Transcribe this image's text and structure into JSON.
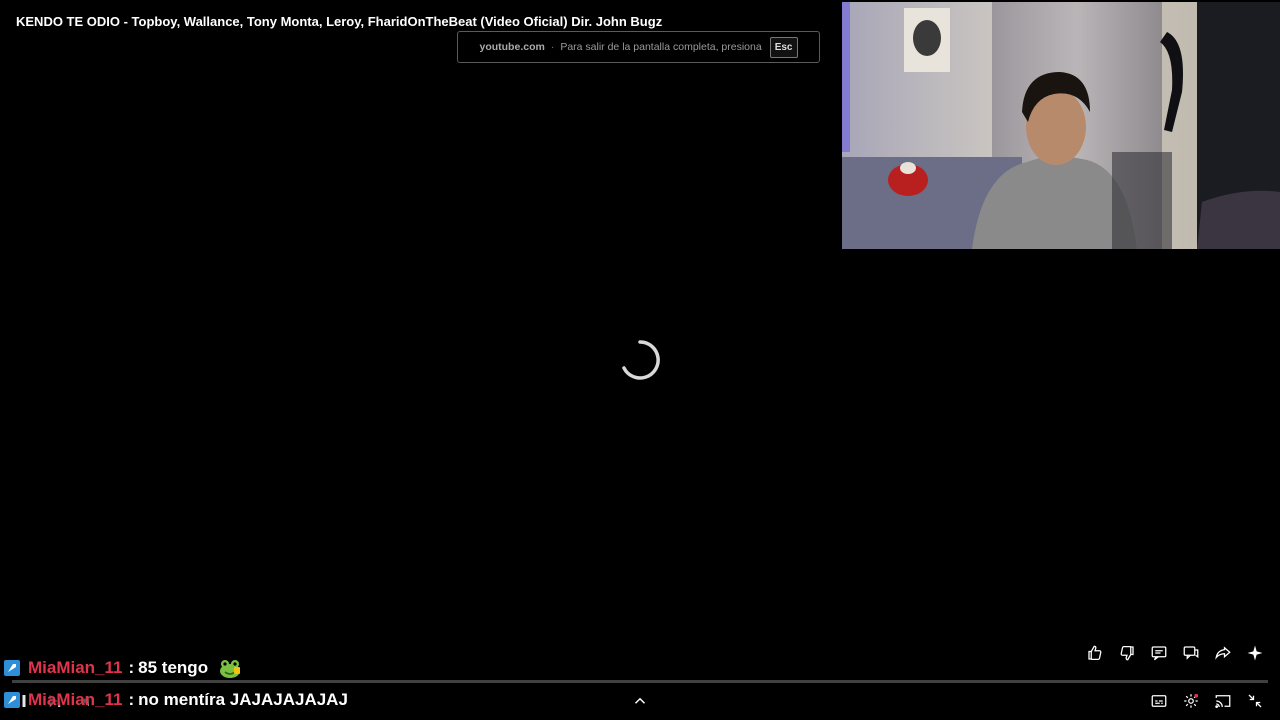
{
  "video": {
    "title": "KENDO TE ODIO - Topboy, Wallance, Tony Monta, Leroy, FharidOnTheBeat (Video Oficial) Dir. John Bugz"
  },
  "fullscreen_notice": {
    "domain": "youtube.com",
    "separator": "·",
    "text": "Para salir de la pantalla completa, presiona",
    "key": "Esc"
  },
  "actions": [
    {
      "name": "like-icon"
    },
    {
      "name": "dislike-icon"
    },
    {
      "name": "comment-icon"
    },
    {
      "name": "chat-icon"
    },
    {
      "name": "share-icon"
    },
    {
      "name": "sparkle-icon"
    }
  ],
  "controls": {
    "bottom_right": [
      {
        "name": "captions-icon"
      },
      {
        "name": "settings-icon"
      },
      {
        "name": "cast-icon"
      },
      {
        "name": "exit-fullscreen-icon"
      }
    ]
  },
  "chat": [
    {
      "user": "MiaMian_11",
      "message": "85 tengo",
      "emote": "frog-emote"
    },
    {
      "user": "MiaMian_11",
      "message": "no mentíra JAJAJAJAJAJ",
      "emote": ""
    }
  ],
  "colors": {
    "username": "#e0344d",
    "badge": "#2e8fd8",
    "background": "#000000"
  }
}
